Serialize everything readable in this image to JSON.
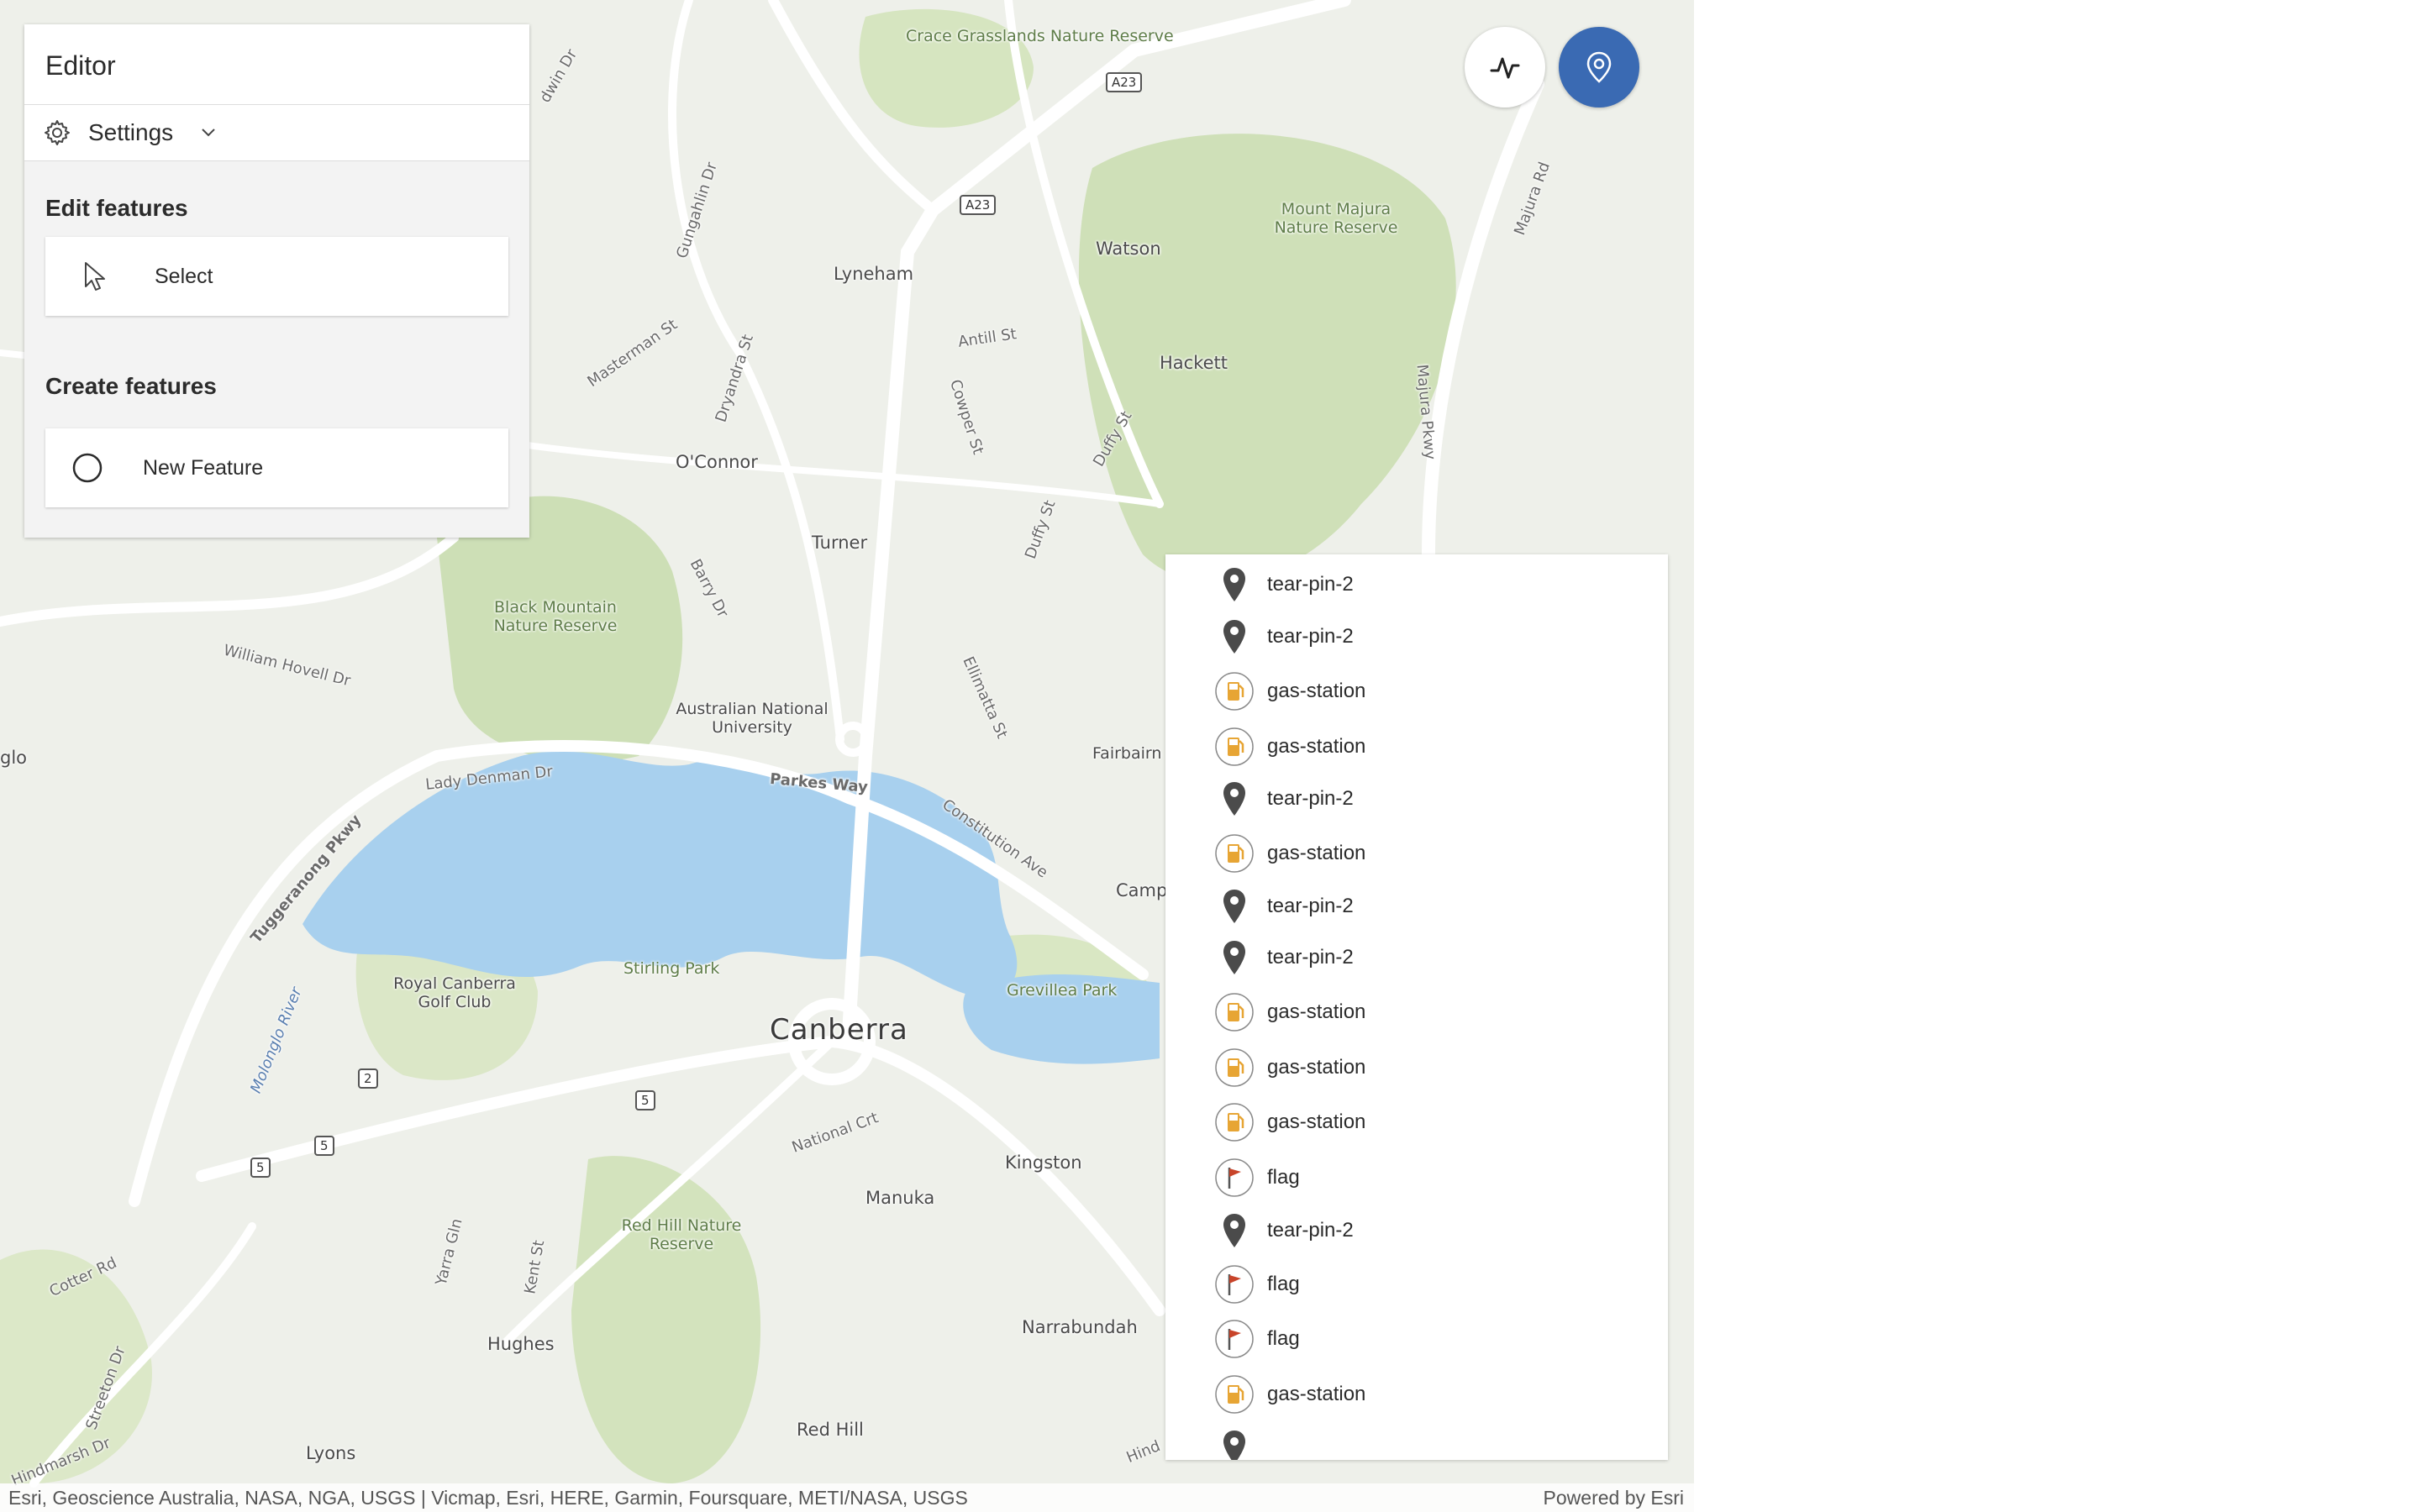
{
  "editor": {
    "title": "Editor",
    "settings_label": "Settings",
    "edit_section": "Edit features",
    "select_label": "Select",
    "create_section": "Create features",
    "new_feature_label": "New Feature"
  },
  "map": {
    "places": {
      "crace": "Crace Grasslands Nature Reserve",
      "lyneham": "Lyneham",
      "watson": "Watson",
      "hackett": "Hackett",
      "majura": "Mount Majura Nature Reserve",
      "oconnor": "O'Connor",
      "turner": "Turner",
      "black_mountain": "Black Mountain Nature Reserve",
      "anu": "Australian National University",
      "canberra": "Canberra",
      "royal_canberra": "Royal Canberra Golf Club",
      "stirling": "Stirling Park",
      "grevillea": "Grevillea Park",
      "kingston": "Kingston",
      "manuka": "Manuka",
      "red_hill_reserve": "Red Hill Nature Reserve",
      "narrabundah": "Narrabundah",
      "hughes": "Hughes",
      "lyons": "Lyons",
      "red_hill": "Red Hill",
      "campbell": "Camp",
      "fairbairn": "Fairbairn",
      "glo": "glo"
    },
    "roads": {
      "gungahlin": "Gungahlin Dr",
      "antill": "Antill St",
      "dryandra": "Dryandra St",
      "masterman": "Masterman St",
      "cowper": "Cowper St",
      "duffy_st": "Duffy St",
      "duffy": "Duffy St",
      "majura_pkwy": "Majura Pkwy",
      "majura_rd": "Majura Rd",
      "barry": "Barry Dr",
      "william_hovell": "William Hovell Dr",
      "lady_denman": "Lady Denman Dr",
      "parkes": "Parkes Way",
      "constitution": "Constitution Ave",
      "ellimatta": "Ellimatta St",
      "tuggeranong": "Tuggeranong Pkwy",
      "molonglo": "Molonglo River",
      "national": "National Crt",
      "yarra_glen": "Yarra Gln",
      "kent": "Kent St",
      "cotter": "Cotter Rd",
      "streeton": "Streeton Dr",
      "hindmarsh": "Hindmarsh Dr",
      "baldwin": "dwin Dr",
      "hind": "Hind"
    },
    "shields": {
      "a23a": "A23",
      "a23b": "A23",
      "r2": "2",
      "r5a": "5",
      "r5b": "5",
      "r5c": "5"
    }
  },
  "features": [
    {
      "icon": "tear-pin-icon",
      "label": "tear-pin-2"
    },
    {
      "icon": "tear-pin-icon",
      "label": "tear-pin-2"
    },
    {
      "icon": "gas-station-icon",
      "label": "gas-station"
    },
    {
      "icon": "gas-station-icon",
      "label": "gas-station"
    },
    {
      "icon": "tear-pin-icon",
      "label": "tear-pin-2"
    },
    {
      "icon": "gas-station-icon",
      "label": "gas-station"
    },
    {
      "icon": "tear-pin-icon",
      "label": "tear-pin-2"
    },
    {
      "icon": "tear-pin-icon",
      "label": "tear-pin-2"
    },
    {
      "icon": "gas-station-icon",
      "label": "gas-station"
    },
    {
      "icon": "gas-station-icon",
      "label": "gas-station"
    },
    {
      "icon": "gas-station-icon",
      "label": "gas-station"
    },
    {
      "icon": "flag-icon",
      "label": "flag"
    },
    {
      "icon": "tear-pin-icon",
      "label": "tear-pin-2"
    },
    {
      "icon": "flag-icon",
      "label": "flag"
    },
    {
      "icon": "flag-icon",
      "label": "flag"
    },
    {
      "icon": "gas-station-icon",
      "label": "gas-station"
    },
    {
      "icon": "tear-pin-icon",
      "label": ""
    }
  ],
  "attribution": {
    "left": "Esri, Geoscience Australia, NASA, NGA, USGS | Vicmap, Esri, HERE, Garmin, Foursquare, METI/NASA, USGS",
    "right": "Powered by Esri"
  },
  "colors": {
    "accent": "#3a6ab3",
    "gas": "#e7a534",
    "flag": "#c8442a",
    "pin": "#4b4b4b",
    "water": "#a8d0ee",
    "park": "#d5e3c0"
  }
}
